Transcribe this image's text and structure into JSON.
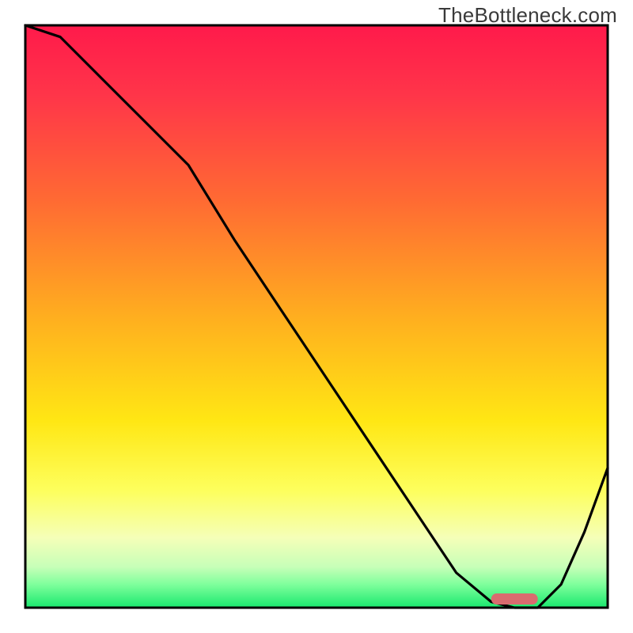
{
  "watermark": "TheBottleneck.com",
  "colors": {
    "curve": "#000000",
    "marker": "#d96b6f"
  },
  "chart_data": {
    "type": "line",
    "title": "",
    "xlabel": "",
    "ylabel": "",
    "xlim": [
      0,
      100
    ],
    "ylim": [
      0,
      100
    ],
    "x": [
      0,
      6,
      12,
      20,
      28,
      36,
      44,
      52,
      60,
      68,
      74,
      80,
      84,
      88,
      92,
      96,
      100
    ],
    "values": [
      104,
      98,
      92,
      84,
      76,
      63,
      51,
      39,
      27,
      15,
      6,
      1,
      0,
      0,
      4,
      13,
      24
    ],
    "optimal_range_x": [
      80,
      88
    ],
    "optimal_marker_y": 1.5
  }
}
